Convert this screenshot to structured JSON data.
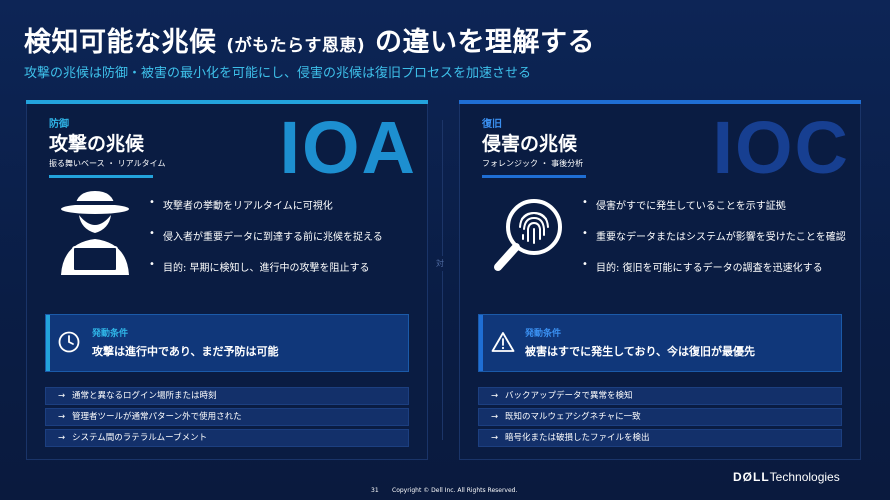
{
  "header": {
    "title_main": "検知可能な兆候",
    "title_paren": "(がもたらす恩恵)",
    "title_tail": "の違いを理解する",
    "subtitle": "攻撃の兆候は防御・被害の最小化を可能にし、侵害の兆候は復旧プロセスを加速させる"
  },
  "left": {
    "label": "防御",
    "heading": "攻撃の兆候",
    "tagline": "振る舞いベース ・ リアルタイム",
    "code": "IOA",
    "bullets": [
      "攻撃者の挙動をリアルタイムに可視化",
      "侵入者が重要データに到達する前に兆候を捉える",
      "目的: 早期に検知し、進行中の攻撃を阻止する"
    ],
    "condition_label": "発動条件",
    "condition_text": "攻撃は進行中であり、まだ予防は可能",
    "items": [
      "通常と異なるログイン場所または時刻",
      "管理者ツールが通常パターン外で使用された",
      "システム間のラテラルムーブメント"
    ]
  },
  "right": {
    "label": "復旧",
    "heading": "侵害の兆候",
    "tagline": "フォレンジック ・ 事後分析",
    "code": "IOC",
    "bullets": [
      "侵害がすでに発生していることを示す証拠",
      "重要なデータまたはシステムが影響を受けたことを確認",
      "目的: 復旧を可能にするデータの調査を迅速化する"
    ],
    "condition_label": "発動条件",
    "condition_text": "被害はすでに発生しており、今は復旧が最優先",
    "items": [
      "バックアップデータで異常を検知",
      "既知のマルウェアシグネチャに一致",
      "暗号化または破損したファイルを検出"
    ]
  },
  "vs_label": "対",
  "arrow_glyph": "→",
  "footer": {
    "page_number": "31",
    "copyright": "Copyright © Dell Inc. All Rights Reserved.",
    "logo_brand": "DØLL",
    "logo_suffix": "Technologies"
  },
  "colors": {
    "background": "#0b2049",
    "accent_cyan": "#23a3dc",
    "accent_blue": "#1f6ed4",
    "subtitle": "#3ec0ea"
  },
  "icons": {
    "left_illustration": "hacker-icon",
    "left_condition": "clock-icon",
    "right_illustration": "fingerprint-search-icon",
    "right_condition": "warning-icon"
  }
}
